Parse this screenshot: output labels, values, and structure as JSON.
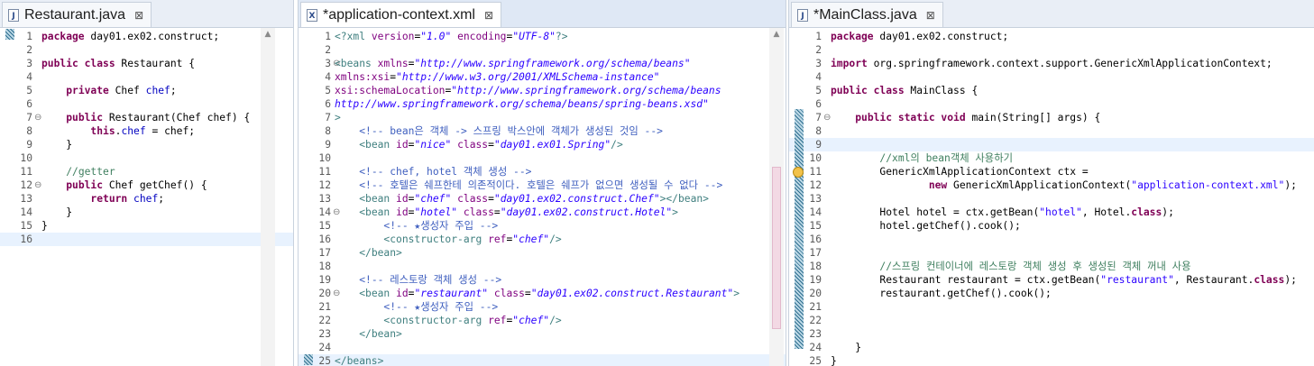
{
  "editors": [
    {
      "id": "restaurant",
      "tab": {
        "title": "Restaurant.java",
        "icon": "java-file-icon"
      },
      "lines": [
        {
          "n": "1",
          "fold": "",
          "html": "<span class=\"kw\">package</span> day01.ex02.construct;"
        },
        {
          "n": "2",
          "fold": "",
          "html": ""
        },
        {
          "n": "3",
          "fold": "",
          "html": "<span class=\"kw\">public class</span> Restaurant {"
        },
        {
          "n": "4",
          "fold": "",
          "html": ""
        },
        {
          "n": "5",
          "fold": "",
          "html": "    <span class=\"kw\">private</span> Chef <span class=\"fld\">chef</span>;"
        },
        {
          "n": "6",
          "fold": "",
          "html": ""
        },
        {
          "n": "7",
          "fold": "⊖",
          "html": "    <span class=\"kw\">public</span> Restaurant(Chef chef) {"
        },
        {
          "n": "8",
          "fold": "",
          "html": "        <span class=\"kw\">this</span>.<span class=\"fld\">chef</span> = chef;"
        },
        {
          "n": "9",
          "fold": "",
          "html": "    }"
        },
        {
          "n": "10",
          "fold": "",
          "html": ""
        },
        {
          "n": "11",
          "fold": "",
          "html": "    <span class=\"cmt\">//getter</span>"
        },
        {
          "n": "12",
          "fold": "⊖",
          "html": "    <span class=\"kw\">public</span> Chef getChef() {"
        },
        {
          "n": "13",
          "fold": "",
          "html": "        <span class=\"kw\">return</span> <span class=\"fld\">chef</span>;"
        },
        {
          "n": "14",
          "fold": "",
          "html": "    }"
        },
        {
          "n": "15",
          "fold": "",
          "html": "}"
        },
        {
          "n": "16",
          "fold": "",
          "html": ""
        }
      ],
      "current_line": 16
    },
    {
      "id": "appctx",
      "tab": {
        "title": "*application-context.xml",
        "icon": "xml-file-icon"
      },
      "lines": [
        {
          "n": "1",
          "fold": "",
          "html": "<span class=\"tag\">&lt;?xml</span> <span class=\"attr\">version</span>=<span class=\"aval\">\"1.0\"</span> <span class=\"attr\">encoding</span>=<span class=\"aval\">\"UTF-8\"</span><span class=\"tag\">?&gt;</span>"
        },
        {
          "n": "2",
          "fold": "",
          "html": ""
        },
        {
          "n": "3",
          "fold": "⊖",
          "html": "<span class=\"tag\">&lt;beans</span> <span class=\"attr\">xmlns</span>=<span class=\"aval\">\"http://www.springframework.org/schema/beans\"</span>"
        },
        {
          "n": "4",
          "fold": "",
          "html": "<span class=\"attr\">xmlns:xsi</span>=<span class=\"aval\">\"http://www.w3.org/2001/XMLSchema-instance\"</span>"
        },
        {
          "n": "5",
          "fold": "",
          "html": "<span class=\"attr\">xsi:schemaLocation</span>=<span class=\"aval\">\"http://www.springframework.org/schema/beans</span>"
        },
        {
          "n": "6",
          "fold": "",
          "html": "<span class=\"aval\">http://www.springframework.org/schema/beans/spring-beans.xsd\"</span>"
        },
        {
          "n": "7",
          "fold": "",
          "html": "<span class=\"tag\">&gt;</span>"
        },
        {
          "n": "8",
          "fold": "",
          "html": "    <span class=\"xcmt\">&lt;!-- bean은 객체 -&gt; 스프링 박스안에 객체가 생성된 것임 --&gt;</span>"
        },
        {
          "n": "9",
          "fold": "",
          "html": "    <span class=\"tag\">&lt;bean</span> <span class=\"attr\">id</span>=<span class=\"aval\">\"nice\"</span> <span class=\"attr\">class</span>=<span class=\"aval\">\"day01.ex01.Spring\"</span><span class=\"tag\">/&gt;</span>"
        },
        {
          "n": "10",
          "fold": "",
          "html": ""
        },
        {
          "n": "11",
          "fold": "",
          "html": "    <span class=\"xcmt\">&lt;!-- chef, hotel 객체 생성 --&gt;</span>"
        },
        {
          "n": "12",
          "fold": "",
          "html": "    <span class=\"xcmt\">&lt;!-- 호텔은 쉐프한테 의존적이다. 호텔은 쉐프가 없으면 생성될 수 없다 --&gt;</span>"
        },
        {
          "n": "13",
          "fold": "",
          "html": "    <span class=\"tag\">&lt;bean</span> <span class=\"attr\">id</span>=<span class=\"aval\">\"chef\"</span> <span class=\"attr\">class</span>=<span class=\"aval\">\"day01.ex02.construct.Chef\"</span><span class=\"tag\">&gt;&lt;/bean&gt;</span>"
        },
        {
          "n": "14",
          "fold": "⊖",
          "html": "    <span class=\"tag\">&lt;bean</span> <span class=\"attr\">id</span>=<span class=\"aval\">\"hotel\"</span> <span class=\"attr\">class</span>=<span class=\"aval\">\"day01.ex02.construct.Hotel\"</span><span class=\"tag\">&gt;</span>"
        },
        {
          "n": "15",
          "fold": "",
          "html": "        <span class=\"xcmt\">&lt;!-- ★생성자 주입 --&gt;</span>"
        },
        {
          "n": "16",
          "fold": "",
          "html": "        <span class=\"tag\">&lt;constructor-arg</span> <span class=\"attr\">ref</span>=<span class=\"aval\">\"chef\"</span><span class=\"tag\">/&gt;</span>"
        },
        {
          "n": "17",
          "fold": "",
          "html": "    <span class=\"tag\">&lt;/bean&gt;</span>"
        },
        {
          "n": "18",
          "fold": "",
          "html": ""
        },
        {
          "n": "19",
          "fold": "",
          "html": "    <span class=\"xcmt\">&lt;!-- 레스토랑 객체 생성 --&gt;</span>"
        },
        {
          "n": "20",
          "fold": "⊖",
          "html": "    <span class=\"tag\">&lt;bean</span> <span class=\"attr\">id</span>=<span class=\"aval\">\"restaurant\"</span> <span class=\"attr\">class</span>=<span class=\"aval\">\"day01.ex02.construct.Restaurant\"</span><span class=\"tag\">&gt;</span>"
        },
        {
          "n": "21",
          "fold": "",
          "html": "        <span class=\"xcmt\">&lt;!-- ★생성자 주입 --&gt;</span>"
        },
        {
          "n": "22",
          "fold": "",
          "html": "        <span class=\"tag\">&lt;constructor-arg</span> <span class=\"attr\">ref</span>=<span class=\"aval\">\"chef\"</span><span class=\"tag\">/&gt;</span>"
        },
        {
          "n": "23",
          "fold": "",
          "html": "    <span class=\"tag\">&lt;/bean&gt;</span>"
        },
        {
          "n": "24",
          "fold": "",
          "html": ""
        },
        {
          "n": "25",
          "fold": "",
          "html": "<span class=\"tag\">&lt;/beans&gt;</span>"
        }
      ],
      "current_line": 25
    },
    {
      "id": "mainclass",
      "tab": {
        "title": "*MainClass.java",
        "icon": "java-file-icon"
      },
      "lines": [
        {
          "n": "1",
          "fold": "",
          "html": "<span class=\"kw\">package</span> day01.ex02.construct;"
        },
        {
          "n": "2",
          "fold": "",
          "html": ""
        },
        {
          "n": "3",
          "fold": "",
          "html": "<span class=\"kw\">import</span> org.springframework.context.support.GenericXmlApplicationContext;"
        },
        {
          "n": "4",
          "fold": "",
          "html": ""
        },
        {
          "n": "5",
          "fold": "",
          "html": "<span class=\"kw\">public class</span> MainClass {"
        },
        {
          "n": "6",
          "fold": "",
          "html": ""
        },
        {
          "n": "7",
          "fold": "⊖",
          "html": "    <span class=\"kw\">public static void</span> main(String[] args) {"
        },
        {
          "n": "8",
          "fold": "",
          "html": ""
        },
        {
          "n": "9",
          "fold": "",
          "html": ""
        },
        {
          "n": "10",
          "fold": "",
          "html": "        <span class=\"cmt\">//xml의 bean객체 사용하기</span>"
        },
        {
          "n": "11",
          "fold": "",
          "html": "        GenericXmlApplicationContext ctx ="
        },
        {
          "n": "12",
          "fold": "",
          "html": "                <span class=\"kw\">new</span> GenericXmlApplicationContext(<span class=\"str\">\"application-context.xml\"</span>);"
        },
        {
          "n": "13",
          "fold": "",
          "html": ""
        },
        {
          "n": "14",
          "fold": "",
          "html": "        Hotel hotel = ctx.getBean(<span class=\"str\">\"hotel\"</span>, Hotel.<span class=\"kw\">class</span>);"
        },
        {
          "n": "15",
          "fold": "",
          "html": "        hotel.getChef().cook();"
        },
        {
          "n": "16",
          "fold": "",
          "html": ""
        },
        {
          "n": "17",
          "fold": "",
          "html": ""
        },
        {
          "n": "18",
          "fold": "",
          "html": "        <span class=\"cmt\">//스프링 컨테이너에 레스토랑 객체 생성 후 생성된 객체 꺼내 사용</span>"
        },
        {
          "n": "19",
          "fold": "",
          "html": "        Restaurant restaurant = ctx.getBean(<span class=\"str\">\"restaurant\"</span>, Restaurant.<span class=\"kw\">class</span>);"
        },
        {
          "n": "20",
          "fold": "",
          "html": "        restaurant.getChef().cook();"
        },
        {
          "n": "21",
          "fold": "",
          "html": ""
        },
        {
          "n": "22",
          "fold": "",
          "html": ""
        },
        {
          "n": "23",
          "fold": "",
          "html": ""
        },
        {
          "n": "24",
          "fold": "",
          "html": "    }"
        },
        {
          "n": "25",
          "fold": "",
          "html": "}"
        }
      ],
      "current_line": 9
    }
  ]
}
